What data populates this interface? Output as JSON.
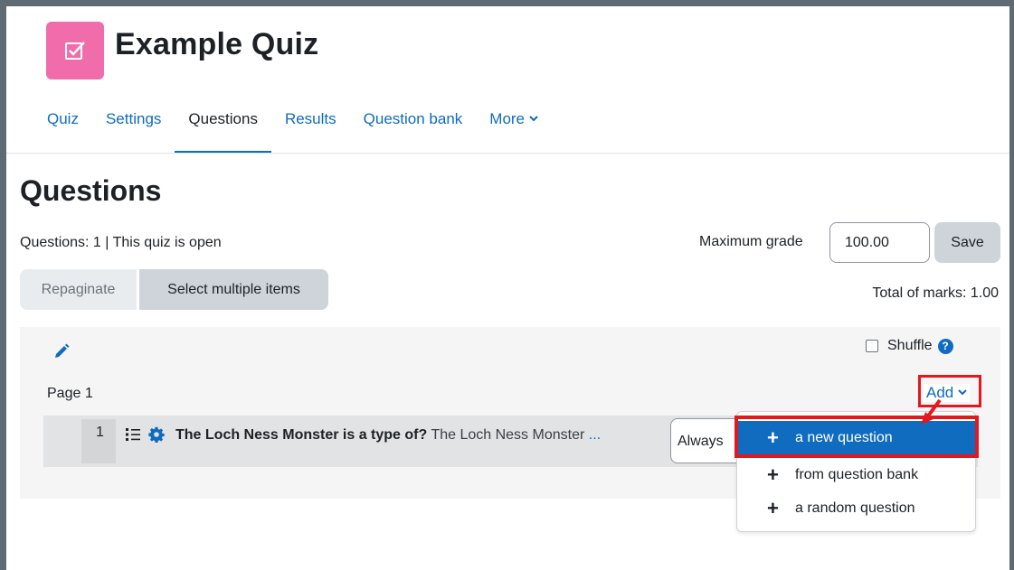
{
  "colors": {
    "brand": "#0f6cbf",
    "quiz_icon_bg": "#f06cab",
    "highlight_red": "#e3181e"
  },
  "header": {
    "icon": "checkbox-icon",
    "title": "Example Quiz"
  },
  "nav": {
    "tabs": [
      {
        "label": "Quiz"
      },
      {
        "label": "Settings"
      },
      {
        "label": "Questions",
        "active": true
      },
      {
        "label": "Results"
      },
      {
        "label": "Question bank"
      },
      {
        "label": "More"
      }
    ]
  },
  "main": {
    "title": "Questions",
    "info": "Questions: 1 | This quiz is open",
    "max_grade_label": "Maximum grade",
    "max_grade_value": "100.00",
    "save_label": "Save",
    "repaginate_label": "Repaginate",
    "select_multiple_label": "Select multiple items",
    "total_marks": "Total of marks: 1.00"
  },
  "section": {
    "edit_icon": "pencil-icon",
    "shuffle_label": "Shuffle",
    "shuffle_checked": false,
    "help_icon": "question-circle-icon",
    "page_label": "Page 1",
    "add_label": "Add"
  },
  "question": {
    "number": "1",
    "type_icon": "list-icon",
    "settings_icon": "gear-icon",
    "name": "The Loch Ness Monster is a type of?",
    "preview": "The Loch Ness Monster",
    "ellipsis": "...",
    "dependency_value": "Always"
  },
  "dropdown": {
    "items": [
      {
        "label": "a new question",
        "icon": "plus-icon",
        "highlighted": true
      },
      {
        "label": "from question bank",
        "icon": "plus-icon"
      },
      {
        "label": "a random question",
        "icon": "plus-icon"
      }
    ]
  }
}
